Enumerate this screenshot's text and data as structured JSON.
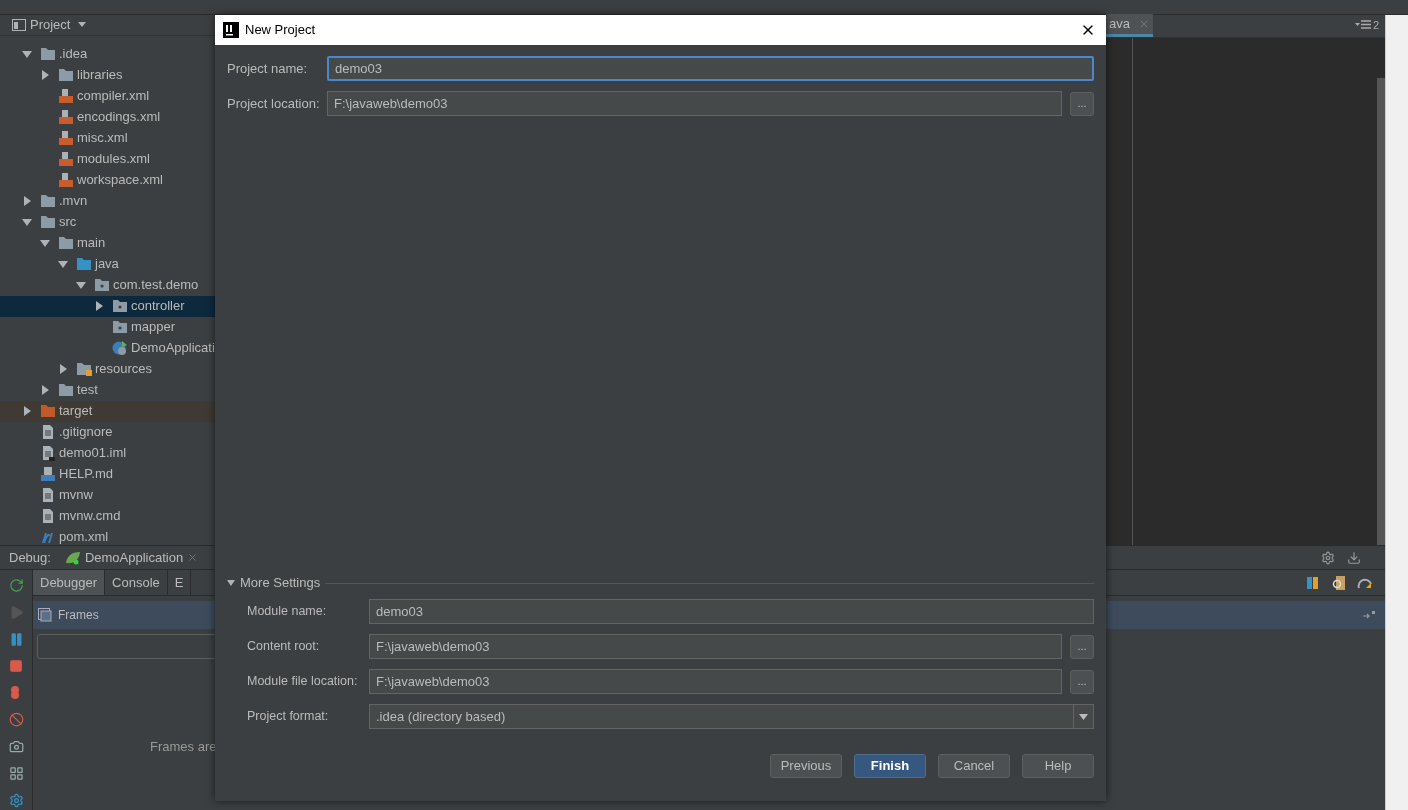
{
  "project_panel": {
    "title": "Project",
    "tree": [
      {
        "label": ".idea",
        "kind": "folder",
        "expanded": true,
        "selected": false,
        "children": [
          {
            "label": "libraries",
            "kind": "folder",
            "expanded": false,
            "selected": false
          },
          {
            "label": "compiler.xml",
            "kind": "xml",
            "selected": false
          },
          {
            "label": "encodings.xml",
            "kind": "xml",
            "selected": false
          },
          {
            "label": "misc.xml",
            "kind": "xml",
            "selected": false
          },
          {
            "label": "modules.xml",
            "kind": "xml",
            "selected": false
          },
          {
            "label": "workspace.xml",
            "kind": "xml",
            "selected": false
          }
        ]
      },
      {
        "label": ".mvn",
        "kind": "folder",
        "expanded": false,
        "selected": false
      },
      {
        "label": "src",
        "kind": "folder",
        "expanded": true,
        "selected": false,
        "children": [
          {
            "label": "main",
            "kind": "folder",
            "expanded": true,
            "selected": false,
            "children": [
              {
                "label": "java",
                "kind": "source",
                "expanded": true,
                "selected": false,
                "children": [
                  {
                    "label": "com.test.demo",
                    "kind": "package",
                    "expanded": true,
                    "selected": false,
                    "children": [
                      {
                        "label": "controller",
                        "kind": "package",
                        "expanded": false,
                        "selected": true
                      },
                      {
                        "label": "mapper",
                        "kind": "package",
                        "selected": false
                      },
                      {
                        "label": "DemoApplicati",
                        "kind": "spring",
                        "selected": false
                      }
                    ]
                  }
                ]
              },
              {
                "label": "resources",
                "kind": "resources",
                "expanded": false,
                "selected": false
              }
            ]
          },
          {
            "label": "test",
            "kind": "folder",
            "expanded": false,
            "selected": false
          }
        ]
      },
      {
        "label": "target",
        "kind": "excluded",
        "expanded": false,
        "selected": false
      },
      {
        "label": ".gitignore",
        "kind": "file",
        "selected": false
      },
      {
        "label": "demo01.iml",
        "kind": "iml",
        "selected": false
      },
      {
        "label": "HELP.md",
        "kind": "md",
        "selected": false
      },
      {
        "label": "mvnw",
        "kind": "file",
        "selected": false
      },
      {
        "label": "mvnw.cmd",
        "kind": "file",
        "selected": false
      },
      {
        "label": "pom.xml",
        "kind": "maven",
        "selected": false
      }
    ]
  },
  "editor": {
    "tab": {
      "label": "ava"
    },
    "tab_count": "2"
  },
  "debug": {
    "label": "Debug:",
    "session": "DemoApplication",
    "tabs": [
      {
        "label": "Debugger",
        "selected": true
      },
      {
        "label": "Console",
        "selected": false
      },
      {
        "label": "E",
        "selected": false
      }
    ],
    "frames": {
      "title": "Frames",
      "empty_text": "Frames are"
    }
  },
  "dialog": {
    "title": "New Project",
    "fields": [
      {
        "kind": "text",
        "label": "Project name:",
        "value": "demo03",
        "focused": true
      },
      {
        "kind": "browse",
        "label": "Project location:",
        "value": "F:\\javaweb\\demo03",
        "focused": false
      }
    ],
    "more_settings": {
      "label": "More Settings",
      "expanded": true,
      "fields": [
        {
          "kind": "text",
          "label": "Module name:",
          "value": "demo03"
        },
        {
          "kind": "browse",
          "label": "Content root:",
          "value": "F:\\javaweb\\demo03"
        },
        {
          "kind": "browse",
          "label": "Module file location:",
          "value": "F:\\javaweb\\demo03"
        },
        {
          "kind": "select",
          "label": "Project format:",
          "value": ".idea (directory based)"
        }
      ]
    },
    "browse_label": "...",
    "buttons": [
      {
        "label": "Previous",
        "default": false
      },
      {
        "label": "Finish",
        "default": true
      },
      {
        "label": "Cancel",
        "default": false
      },
      {
        "label": "Help",
        "default": false
      }
    ]
  }
}
